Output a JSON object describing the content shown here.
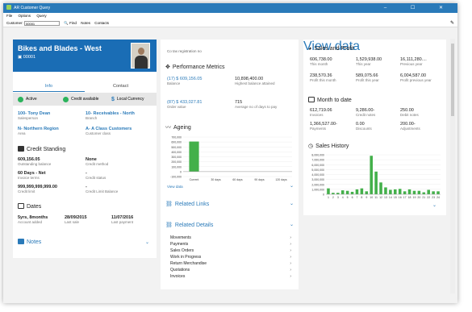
{
  "window": {
    "title": "AR Customer Query",
    "controls": "–  ☐  ✕"
  },
  "menu": {
    "items": [
      "File",
      "Options",
      "Query"
    ]
  },
  "toolbar": {
    "customer_label": "Customer:",
    "customer_value": "00001",
    "find": "Find",
    "notes": "Notes",
    "contacts": "Contacts"
  },
  "customer": {
    "name": "Bikes and Blades - West",
    "number": "00001"
  },
  "tabs": {
    "info": "Info",
    "contact": "Contact"
  },
  "status": {
    "active": "Active",
    "credit": "Credit available",
    "currency": "Local Currency"
  },
  "info": {
    "salesperson_value": "100- Tony Dean",
    "salesperson_label": "Salesperson",
    "branch_value": "10- Receivables - North",
    "branch_label": "Branch",
    "area_value": "N- Northern Region",
    "area_label": "Area",
    "class_value": "A- A Class Customers",
    "class_label": "Customer class"
  },
  "credit": {
    "title": "Credit Standing",
    "outstanding_value": "609,156.05",
    "outstanding_label": "Outstanding balance",
    "method_value": "None",
    "method_label": "Credit method",
    "terms_value": "60 Days - Net",
    "terms_label": "Invoice terms",
    "status_value": "-",
    "status_label": "Credit status",
    "limit_value": "999,999,999,999.00",
    "limit_label": "Credit limit",
    "climit_value": "-",
    "climit_label": "Credit Limit Balance"
  },
  "dates": {
    "title": "Dates",
    "age_value": "5yrs, 8months",
    "age_label": "Account added",
    "lastsale_value": "28/09/2015",
    "lastsale_label": "Last sale",
    "lastpay_value": "11/07/2016",
    "lastpay_label": "Last payment"
  },
  "notes": {
    "title": "Notes"
  },
  "mid": {
    "tax": "Co tax registration no",
    "perf_title": "Performance Metrics",
    "balance_value": "(17) $ 609,156.05",
    "balance_label": "Balance",
    "highest_value": "10,898,400.00",
    "highest_label": "Highest balance attained",
    "order_value": "(87) $ 433,027.81",
    "order_label": "Order value",
    "avg_value": "715",
    "avg_label": "Average no of days to pay",
    "ageing_title": "Ageing",
    "view_data": "View data",
    "related_links": "Related Links",
    "related_details": "Related Details",
    "details": [
      "Movements",
      "Payments",
      "Sales Orders",
      "Work in Progress",
      "Return Merchandise",
      "Quotations",
      "Invoices"
    ]
  },
  "right": {
    "sales_title": "Sales and Profit",
    "this_month_value": "606,738.00",
    "this_month_label": "This month",
    "this_year_value": "1,529,938.00",
    "this_year_label": "This year",
    "prev_year_value": "16,111,280....",
    "prev_year_label": "Previous year",
    "pm_value": "238,570.36",
    "pm_label": "Profit this month",
    "py_value": "589,075.66",
    "py_label": "Profit this year",
    "ppy_value": "6,004,587.00",
    "ppy_label": "Profit previous year",
    "mtd_title": "Month to date",
    "inv_value": "612,719.06",
    "inv_label": "Invoices",
    "cn_value": "9,286.00-",
    "cn_label": "Credit notes",
    "dn_value": "250.00",
    "dn_label": "Debit notes",
    "pay_value": "1,366,527.00-",
    "pay_label": "Payments",
    "disc_value": "0.00",
    "disc_label": "Discounts",
    "adj_value": "200.00-",
    "adj_label": "Adjustments",
    "history_title": "Sales History",
    "view_data": "View data"
  },
  "chart_data": [
    {
      "type": "bar",
      "categories": [
        "Current",
        "30 days",
        "60 days",
        "90 days",
        "120 days"
      ],
      "values": [
        609156,
        0,
        0,
        0,
        0
      ],
      "ylim": [
        -100000,
        700000
      ],
      "ytick_labels": [
        "700,000",
        "600,000",
        "500,000",
        "400,000",
        "300,000",
        "200,000",
        "100,000",
        "0",
        "-100,000"
      ]
    },
    {
      "type": "bar",
      "categories": [
        "1",
        "2",
        "3",
        "4",
        "5",
        "6",
        "7",
        "8",
        "9",
        "10",
        "11",
        "12",
        "13",
        "14",
        "15",
        "16",
        "17",
        "18",
        "19",
        "20",
        "21",
        "22",
        "23",
        "24"
      ],
      "values": [
        1200000,
        300000,
        300000,
        800000,
        700000,
        500000,
        1000000,
        1200000,
        600000,
        7800000,
        4600000,
        2400000,
        1400000,
        900000,
        1000000,
        1100000,
        600000,
        1000000,
        700000,
        700000,
        400000,
        900000,
        600000,
        600000
      ],
      "ylim": [
        0,
        8000000
      ],
      "ytick_labels": [
        "8,000,000",
        "7,000,000",
        "6,000,000",
        "5,000,000",
        "4,000,000",
        "3,000,000",
        "2,000,000",
        "1,000,000",
        "0"
      ]
    }
  ]
}
